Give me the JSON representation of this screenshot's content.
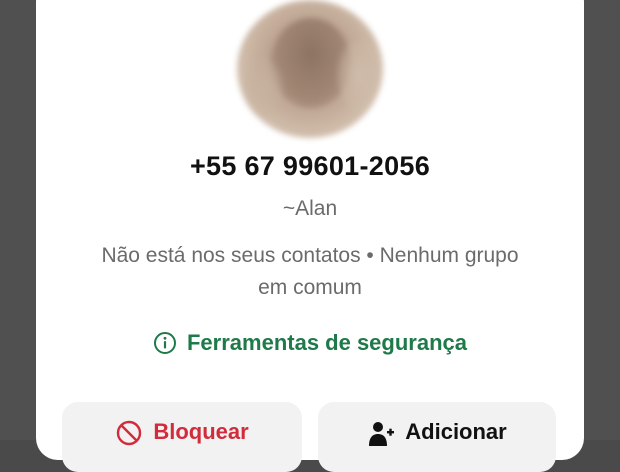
{
  "contact": {
    "phone": "+55 67 99601-2056",
    "pushname": "~Alan",
    "context_line1": "Não está nos seus contatos • Nenhum grupo",
    "context_line2": "em comum"
  },
  "safety": {
    "label": "Ferramentas de segurança",
    "icon": "info-icon",
    "color": "#1f7a4a"
  },
  "actions": {
    "block_label": "Bloquear",
    "block_icon": "block-icon",
    "block_color": "#d22c3c",
    "add_label": "Adicionar",
    "add_icon": "add-contact-icon"
  }
}
